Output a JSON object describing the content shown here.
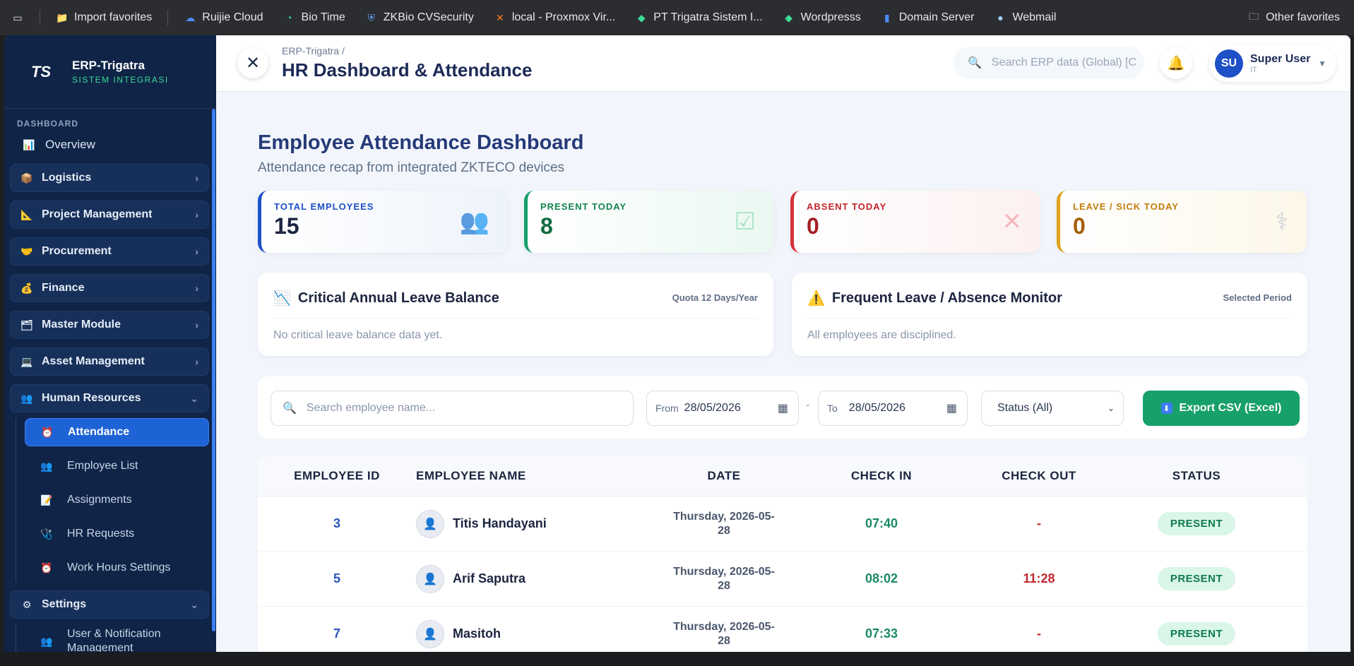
{
  "bookmarks": [
    {
      "label": "Import favorites",
      "icon": "folder-import-icon"
    },
    {
      "label": "Ruijie Cloud",
      "icon": "cloud-icon"
    },
    {
      "label": "Bio Time",
      "icon": "clock-icon"
    },
    {
      "label": "ZKBio CVSecurity",
      "icon": "shield-icon"
    },
    {
      "label": "local - Proxmox Vir...",
      "icon": "proxmox-icon"
    },
    {
      "label": "PT Trigatra Sistem I...",
      "icon": "globe-icon"
    },
    {
      "label": "Wordpresss",
      "icon": "globe-icon"
    },
    {
      "label": "Domain Server",
      "icon": "server-icon"
    },
    {
      "label": "Webmail",
      "icon": "mail-icon"
    }
  ],
  "other_favorites": "Other favorites",
  "brand": {
    "title": "ERP-Trigatra",
    "subtitle": "SISTEM INTEGRASI",
    "logo": "TS"
  },
  "sidebar": {
    "section": "DASHBOARD",
    "overview": "Overview",
    "menus": [
      {
        "label": "Logistics",
        "icon": "box-icon"
      },
      {
        "label": "Project Management",
        "icon": "project-icon"
      },
      {
        "label": "Procurement",
        "icon": "handshake-icon"
      },
      {
        "label": "Finance",
        "icon": "money-bag-icon"
      },
      {
        "label": "Master Module",
        "icon": "folder-icon"
      },
      {
        "label": "Asset Management",
        "icon": "laptop-icon"
      },
      {
        "label": "Human Resources",
        "icon": "people-icon"
      }
    ],
    "hr_items": [
      "Attendance",
      "Employee List",
      "Assignments",
      "HR Requests",
      "Work Hours Settings"
    ],
    "settings": "Settings",
    "settings_items": [
      "User & Notification Management"
    ]
  },
  "header": {
    "breadcrumb": "ERP-Trigatra /",
    "title": "HR Dashboard & Attendance",
    "search_placeholder": "Search ERP data (Global) [C",
    "user_initials": "SU",
    "user_name": "Super User",
    "user_role": "IT"
  },
  "page": {
    "title": "Employee Attendance Dashboard",
    "subtitle": "Attendance recap from integrated ZKTECO devices"
  },
  "cards": [
    {
      "label": "TOTAL EMPLOYEES",
      "value": "15",
      "color": "#1e50c8",
      "bg": "#eef3fb"
    },
    {
      "label": "PRESENT TODAY",
      "value": "8",
      "color": "#17a06a",
      "bg": "#eaf8f1"
    },
    {
      "label": "ABSENT TODAY",
      "value": "0",
      "color": "#d6333a",
      "bg": "#fdf0f0"
    },
    {
      "label": "LEAVE / SICK TODAY",
      "value": "0",
      "color": "#e0a21c",
      "bg": "#fdf7e9"
    }
  ],
  "panels": [
    {
      "title": "Critical Annual Leave Balance",
      "tag": "Quota 12 Days/Year",
      "body": "No critical leave balance data yet.",
      "icon": "chart-down-icon"
    },
    {
      "title": "Frequent Leave / Absence Monitor",
      "tag": "Selected Period",
      "body": "All employees are disciplined.",
      "icon": "warning-icon"
    }
  ],
  "filters": {
    "search_placeholder": "Search employee name...",
    "from_label": "From",
    "from_value": "28/05/2026",
    "to_label": "To",
    "to_value": "28/05/2026",
    "dash": "-",
    "status": "Status (All)",
    "export": "Export CSV (Excel)"
  },
  "table": {
    "headers": [
      "EMPLOYEE ID",
      "EMPLOYEE NAME",
      "DATE",
      "CHECK IN",
      "CHECK OUT",
      "STATUS"
    ],
    "rows": [
      {
        "id": "3",
        "name": "Titis Handayani",
        "date1": "Thursday, 2026-05-",
        "date2": "28",
        "in": "07:40",
        "out": "-",
        "status": "PRESENT"
      },
      {
        "id": "5",
        "name": "Arif Saputra",
        "date1": "Thursday, 2026-05-",
        "date2": "28",
        "in": "08:02",
        "out": "11:28",
        "status": "PRESENT"
      },
      {
        "id": "7",
        "name": "Masitoh",
        "date1": "Thursday, 2026-05-",
        "date2": "28",
        "in": "07:33",
        "out": "-",
        "status": "PRESENT"
      }
    ]
  }
}
